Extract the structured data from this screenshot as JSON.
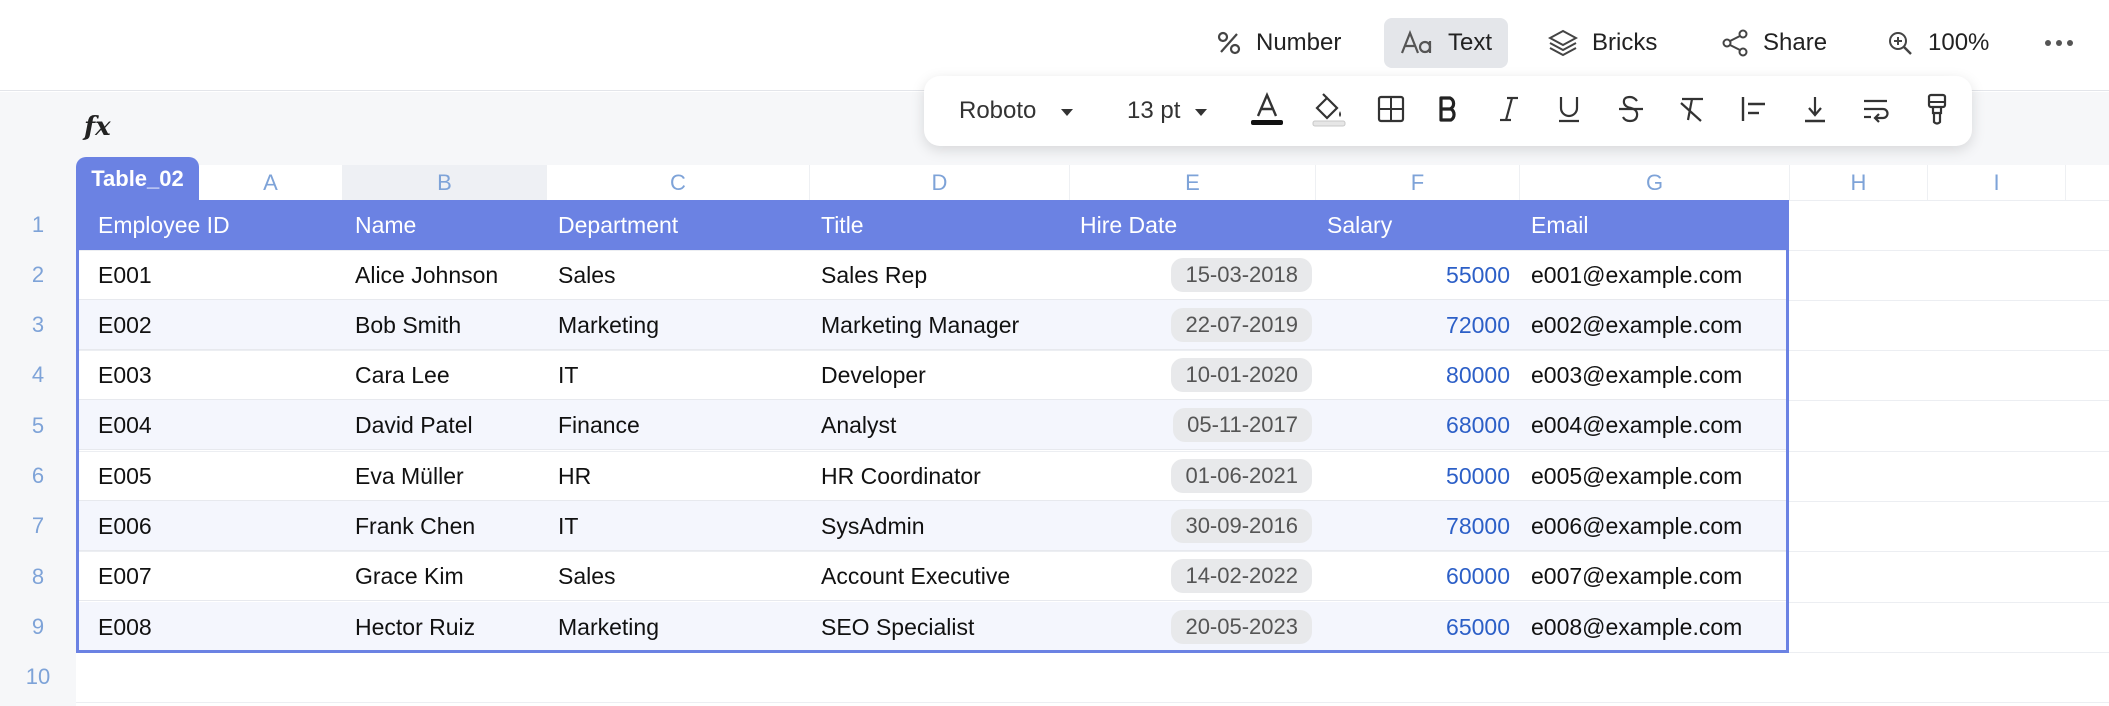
{
  "toolbar": {
    "number_label": "Number",
    "text_label": "Text",
    "bricks_label": "Bricks",
    "share_label": "Share",
    "zoom_label": "100%"
  },
  "formula_bar": {
    "fx_label": "fx"
  },
  "format_bar": {
    "font": "Roboto",
    "size": "13 pt",
    "text_color": "#111111",
    "fill_color": "#f2c14e"
  },
  "sheet": {
    "table_name": "Table_02",
    "columns": [
      "A",
      "B",
      "C",
      "D",
      "E",
      "F",
      "G",
      "H",
      "I"
    ],
    "rows": [
      "1",
      "2",
      "3",
      "4",
      "5",
      "6",
      "7",
      "8",
      "9",
      "10"
    ],
    "selected_column": "B"
  },
  "table": {
    "headers": [
      "Employee ID",
      "Name",
      "Department",
      "Title",
      "Hire Date",
      "Salary",
      "Email"
    ],
    "rows": [
      [
        "E001",
        "Alice Johnson",
        "Sales",
        "Sales Rep",
        "15-03-2018",
        "55000",
        "e001@example.com"
      ],
      [
        "E002",
        "Bob Smith",
        "Marketing",
        "Marketing Manager",
        "22-07-2019",
        "72000",
        "e002@example.com"
      ],
      [
        "E003",
        "Cara Lee",
        "IT",
        "Developer",
        "10-01-2020",
        "80000",
        "e003@example.com"
      ],
      [
        "E004",
        "David Patel",
        "Finance",
        "Analyst",
        "05-11-2017",
        "68000",
        "e004@example.com"
      ],
      [
        "E005",
        "Eva Müller",
        "HR",
        "HR Coordinator",
        "01-06-2021",
        "50000",
        "e005@example.com"
      ],
      [
        "E006",
        "Frank Chen",
        "IT",
        "SysAdmin",
        "30-09-2016",
        "78000",
        "e006@example.com"
      ],
      [
        "E007",
        "Grace Kim",
        "Sales",
        "Account Executive",
        "14-02-2022",
        "60000",
        "e007@example.com"
      ],
      [
        "E008",
        "Hector Ruiz",
        "Marketing",
        "SEO Specialist",
        "20-05-2023",
        "65000",
        "e008@example.com"
      ]
    ]
  },
  "colors": {
    "accent": "#6b82e3",
    "number_text": "#2c5fc7",
    "header_label": "#7ea3d8"
  }
}
